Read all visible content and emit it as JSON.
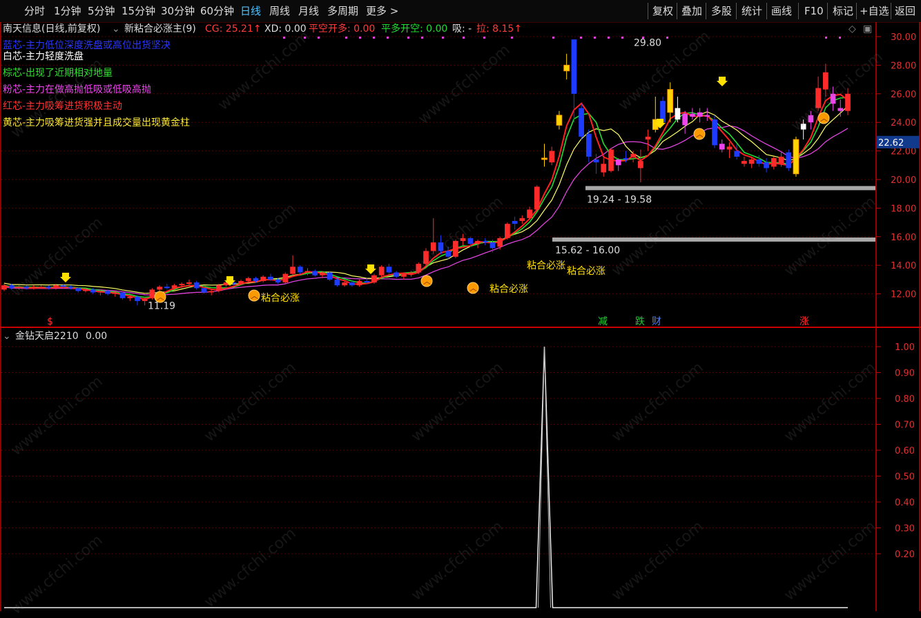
{
  "toolbar": {
    "left": [
      "分时",
      "1分钟",
      "5分钟",
      "15分钟",
      "30分钟",
      "60分钟",
      "日线",
      "周线",
      "月线",
      "多周期",
      "更多 >"
    ],
    "active": "日线",
    "right": [
      "复权",
      "叠加",
      "多股",
      "统计",
      "画线",
      "F10",
      "标记",
      "+自选",
      "返回"
    ]
  },
  "info_bar": {
    "stock": "南天信息(日线,前复权)",
    "indicator": "新粘合必涨主(9)",
    "cg": "CG: 25.21↑",
    "xd": "XD: 0.00",
    "pkkd": "平空开多: 0.00",
    "pdkk": "平多开空: 0.00",
    "xi": "吸: -",
    "la": "拉: 8.15↑"
  },
  "legend": [
    {
      "text": "蓝芯-主力低位深度洗盘或高位出货坚决",
      "color": "#2b36ff"
    },
    {
      "text": "白芯-主力轻度洗盘",
      "color": "#ffffff"
    },
    {
      "text": "棕芯-出现了近期相对地量",
      "color": "#33dd33"
    },
    {
      "text": "粉芯-主力在做高抛低吸或低吸高抛",
      "color": "#ee44ee"
    },
    {
      "text": "红芯-主力吸筹进货积极主动",
      "color": "#ff3333"
    },
    {
      "text": "黄芯-主力吸筹进货强并且成交量出现黄金柱",
      "color": "#ffee33"
    }
  ],
  "colors": {
    "up": "#ff2a2a",
    "down": "#1e3cff",
    "gold": "#ffd700",
    "axis": "#c80000",
    "grid": "#5a0000",
    "ma_red": "#ff2020",
    "ma_green": "#22dd33",
    "ma_magenta": "#dd44dd",
    "ma_yellow": "#ffff66"
  },
  "chart_data": [
    {
      "type": "candlestick",
      "title": "南天信息(日线,前复权)",
      "ylim": [
        10.6,
        30.6
      ],
      "yticks": [
        "30.00",
        "28.00",
        "26.00",
        "24.00",
        "22.00",
        "20.00",
        "18.00",
        "16.00",
        "14.00",
        "12.00"
      ],
      "current_price": "22.62",
      "annotations": {
        "high": "29.80",
        "low": "11.19",
        "zone_upper": "19.24 - 19.58",
        "zone_lower": "15.62 - 16.00",
        "signal": "粘合必涨"
      },
      "signals_bottom": [
        "$",
        "减",
        "跌",
        "财",
        "涨"
      ],
      "candles": [
        [
          12.3,
          12.7,
          12.2,
          12.6,
          "u"
        ],
        [
          12.6,
          12.7,
          12.3,
          12.4,
          "d"
        ],
        [
          12.4,
          12.6,
          12.3,
          12.5,
          "u"
        ],
        [
          12.5,
          12.6,
          12.3,
          12.4,
          "d"
        ],
        [
          12.4,
          12.6,
          12.3,
          12.5,
          "u"
        ],
        [
          12.5,
          12.6,
          12.4,
          12.5,
          "u"
        ],
        [
          12.5,
          12.6,
          12.3,
          12.4,
          "d"
        ],
        [
          12.4,
          12.7,
          12.3,
          12.6,
          "u"
        ],
        [
          12.6,
          12.7,
          12.4,
          12.5,
          "d"
        ],
        [
          12.5,
          12.6,
          12.3,
          12.4,
          "d"
        ],
        [
          12.4,
          12.5,
          12.1,
          12.2,
          "d"
        ],
        [
          12.2,
          12.4,
          12.1,
          12.3,
          "u"
        ],
        [
          12.3,
          12.4,
          12.0,
          12.1,
          "d"
        ],
        [
          12.1,
          12.3,
          11.9,
          12.2,
          "u"
        ],
        [
          12.2,
          12.3,
          11.9,
          12.0,
          "d"
        ],
        [
          12.0,
          12.2,
          11.8,
          12.1,
          "u"
        ],
        [
          12.1,
          12.2,
          11.6,
          11.7,
          "d"
        ],
        [
          11.7,
          11.9,
          11.5,
          11.8,
          "u"
        ],
        [
          11.8,
          11.9,
          11.2,
          11.5,
          "d"
        ],
        [
          11.5,
          11.8,
          11.19,
          11.7,
          "u"
        ],
        [
          11.7,
          12.4,
          11.6,
          12.3,
          "u"
        ],
        [
          12.3,
          12.6,
          12.2,
          12.5,
          "u"
        ],
        [
          12.5,
          12.7,
          12.3,
          12.4,
          "d"
        ],
        [
          12.4,
          12.7,
          12.3,
          12.6,
          "u"
        ],
        [
          12.6,
          12.8,
          12.4,
          12.7,
          "u"
        ],
        [
          12.7,
          13.0,
          12.6,
          12.8,
          "u"
        ],
        [
          12.8,
          12.9,
          12.3,
          12.4,
          "d"
        ],
        [
          12.4,
          12.6,
          12.0,
          12.1,
          "d"
        ],
        [
          12.1,
          12.3,
          11.9,
          12.2,
          "u"
        ],
        [
          12.2,
          12.7,
          12.1,
          12.6,
          "u"
        ],
        [
          12.6,
          12.9,
          12.5,
          12.8,
          "u"
        ],
        [
          12.8,
          12.9,
          12.6,
          12.7,
          "d"
        ],
        [
          12.7,
          13.0,
          12.6,
          12.9,
          "u"
        ],
        [
          12.9,
          13.2,
          12.8,
          13.1,
          "u"
        ],
        [
          13.1,
          13.2,
          12.8,
          12.9,
          "d"
        ],
        [
          12.9,
          13.3,
          12.8,
          13.2,
          "u"
        ],
        [
          13.2,
          13.4,
          12.9,
          13.0,
          "d"
        ],
        [
          13.0,
          13.1,
          12.7,
          12.8,
          "d"
        ],
        [
          12.8,
          13.5,
          12.7,
          13.4,
          "u"
        ],
        [
          13.4,
          14.7,
          13.3,
          13.9,
          "u"
        ],
        [
          13.9,
          14.0,
          13.4,
          13.5,
          "d"
        ],
        [
          13.5,
          13.8,
          13.3,
          13.6,
          "u"
        ],
        [
          13.6,
          13.7,
          13.2,
          13.3,
          "d"
        ],
        [
          13.3,
          13.6,
          13.1,
          13.5,
          "u"
        ],
        [
          13.5,
          13.6,
          12.9,
          13.0,
          "d"
        ],
        [
          13.0,
          13.1,
          12.5,
          12.6,
          "d"
        ],
        [
          12.6,
          12.9,
          12.5,
          12.8,
          "u"
        ],
        [
          12.8,
          12.9,
          12.5,
          12.6,
          "d"
        ],
        [
          12.6,
          13.0,
          12.5,
          12.9,
          "u"
        ],
        [
          12.9,
          13.1,
          12.7,
          12.8,
          "d"
        ],
        [
          12.8,
          13.4,
          12.7,
          13.3,
          "u"
        ],
        [
          13.3,
          14.0,
          13.2,
          13.9,
          "u"
        ],
        [
          13.9,
          14.1,
          13.4,
          13.5,
          "d"
        ],
        [
          13.5,
          13.6,
          13.1,
          13.2,
          "d"
        ],
        [
          13.2,
          13.5,
          13.0,
          13.4,
          "u"
        ],
        [
          13.4,
          13.6,
          13.2,
          13.5,
          "u"
        ],
        [
          13.5,
          14.2,
          13.4,
          14.1,
          "u"
        ],
        [
          14.1,
          15.2,
          13.9,
          15.0,
          "u"
        ],
        [
          15.0,
          17.3,
          14.8,
          15.6,
          "u"
        ],
        [
          15.6,
          16.1,
          14.8,
          15.0,
          "d"
        ],
        [
          15.0,
          15.3,
          14.4,
          14.6,
          "d"
        ],
        [
          14.6,
          15.8,
          14.5,
          15.7,
          "u"
        ],
        [
          15.7,
          16.2,
          15.4,
          15.9,
          "u"
        ],
        [
          15.9,
          16.0,
          15.3,
          15.5,
          "d"
        ],
        [
          15.5,
          15.8,
          15.2,
          15.7,
          "u"
        ],
        [
          15.7,
          15.9,
          15.4,
          15.6,
          "d"
        ],
        [
          15.2,
          15.8,
          14.9,
          15.6,
          "d"
        ],
        [
          15.3,
          16.0,
          15.1,
          15.9,
          "u"
        ],
        [
          15.9,
          17.0,
          15.8,
          16.9,
          "u"
        ],
        [
          16.9,
          17.4,
          16.5,
          17.1,
          "d"
        ],
        [
          17.1,
          17.5,
          16.9,
          17.3,
          "u"
        ],
        [
          17.3,
          18.1,
          17.2,
          17.9,
          "u"
        ],
        [
          17.9,
          19.6,
          17.8,
          19.5,
          "u"
        ],
        [
          21.5,
          22.5,
          20.9,
          21.5,
          "g"
        ],
        [
          22.0,
          22.3,
          21.0,
          21.2,
          "u"
        ],
        [
          23.8,
          24.8,
          23.5,
          24.5,
          "g"
        ],
        [
          27.6,
          28.8,
          27.0,
          28.0,
          "g"
        ],
        [
          29.8,
          29.8,
          24.0,
          26.0,
          "d"
        ],
        [
          25.0,
          25.3,
          22.8,
          23.0,
          "d"
        ],
        [
          23.2,
          23.5,
          21.2,
          21.6,
          "d"
        ],
        [
          21.2,
          21.8,
          20.4,
          21.4,
          "d"
        ],
        [
          21.1,
          21.5,
          20.2,
          20.5,
          "u"
        ],
        [
          20.6,
          22.2,
          20.5,
          22.1,
          "u"
        ],
        [
          21.0,
          21.5,
          20.6,
          21.4,
          "m"
        ],
        [
          21.4,
          22.0,
          21.2,
          21.5,
          "d"
        ],
        [
          21.6,
          22.0,
          21.2,
          21.8,
          "u"
        ],
        [
          21.3,
          22.1,
          19.8,
          20.8,
          "u"
        ],
        [
          23.0,
          23.5,
          22.0,
          22.8,
          "u"
        ],
        [
          23.5,
          25.8,
          23.3,
          24.2,
          "g"
        ],
        [
          24.0,
          25.8,
          23.8,
          25.5,
          "d"
        ],
        [
          26.3,
          26.8,
          24.0,
          24.7,
          "g"
        ],
        [
          25.0,
          25.8,
          24.0,
          24.2,
          "w"
        ],
        [
          23.8,
          24.8,
          23.2,
          24.6,
          "m"
        ],
        [
          24.6,
          25.0,
          24.2,
          24.4,
          "m"
        ],
        [
          24.4,
          25.0,
          24.0,
          24.7,
          "m"
        ],
        [
          24.5,
          25.0,
          24.1,
          24.4,
          "m"
        ],
        [
          24.2,
          24.5,
          22.2,
          22.4,
          "d"
        ],
        [
          22.5,
          22.8,
          21.9,
          22.1,
          "m"
        ],
        [
          22.1,
          22.6,
          21.5,
          22.3,
          "u"
        ],
        [
          22.0,
          22.5,
          21.4,
          21.6,
          "d"
        ],
        [
          21.3,
          21.6,
          20.9,
          21.1,
          "u"
        ],
        [
          21.1,
          21.6,
          20.8,
          21.4,
          "u"
        ],
        [
          21.4,
          21.7,
          20.9,
          21.1,
          "d"
        ],
        [
          21.2,
          21.5,
          20.5,
          20.8,
          "d"
        ],
        [
          20.9,
          21.6,
          20.7,
          21.5,
          "u"
        ],
        [
          21.6,
          22.0,
          20.9,
          21.1,
          "u"
        ],
        [
          21.9,
          22.1,
          20.6,
          20.8,
          "d"
        ],
        [
          20.4,
          23.0,
          20.2,
          22.8,
          "g"
        ],
        [
          23.5,
          24.2,
          22.8,
          23.9,
          "w"
        ],
        [
          24.0,
          24.8,
          23.5,
          24.5,
          "m"
        ],
        [
          25.0,
          27.2,
          24.8,
          26.4,
          "u"
        ],
        [
          26.3,
          28.1,
          25.8,
          27.5,
          "u"
        ],
        [
          26.0,
          26.5,
          24.8,
          25.3,
          "m"
        ],
        [
          25.0,
          25.6,
          24.4,
          24.8,
          "m"
        ],
        [
          26.0,
          26.4,
          24.5,
          24.8,
          "u"
        ]
      ]
    },
    {
      "type": "line",
      "title": "金钻天启2210",
      "value_label": "0.00",
      "ylim": [
        -0.04,
        1.05
      ],
      "yticks": [
        "1.00",
        "0.90",
        "0.80",
        "0.70",
        "0.60",
        "0.50",
        "0.40",
        "0.30",
        "0.20"
      ],
      "series": [
        {
          "name": "金钻天启2210",
          "spike_index": 73,
          "spike_value": 1.0,
          "baseline": 0.0
        }
      ]
    }
  ],
  "watermark": "www.cfchi.com"
}
